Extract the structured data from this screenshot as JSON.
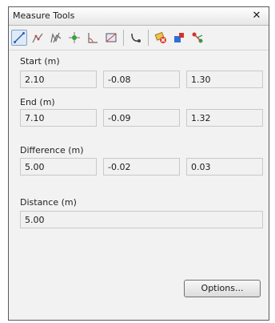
{
  "window": {
    "title": "Measure Tools",
    "close_glyph": "✕"
  },
  "toolbar": {
    "tools": [
      {
        "icon": "measure-line-icon",
        "active": true
      },
      {
        "icon": "measure-polyline-icon"
      },
      {
        "icon": "measure-multi-path-icon"
      },
      {
        "icon": "measure-point-icon"
      },
      {
        "icon": "measure-angle-icon"
      },
      {
        "icon": "measure-area-icon"
      },
      {
        "icon": "snap-icon"
      },
      {
        "icon": "clear-measure-icon"
      },
      {
        "icon": "export-icon"
      },
      {
        "icon": "settings-connect-icon"
      }
    ]
  },
  "start": {
    "label": "Start (m)",
    "x": "2.10",
    "y": "-0.08",
    "z": "1.30"
  },
  "end": {
    "label": "End (m)",
    "x": "7.10",
    "y": "-0.09",
    "z": "1.32"
  },
  "difference": {
    "label": "Difference (m)",
    "x": "5.00",
    "y": "-0.02",
    "z": "0.03"
  },
  "distance": {
    "label": "Distance (m)",
    "value": "5.00"
  },
  "options_button": {
    "label": "Options..."
  }
}
